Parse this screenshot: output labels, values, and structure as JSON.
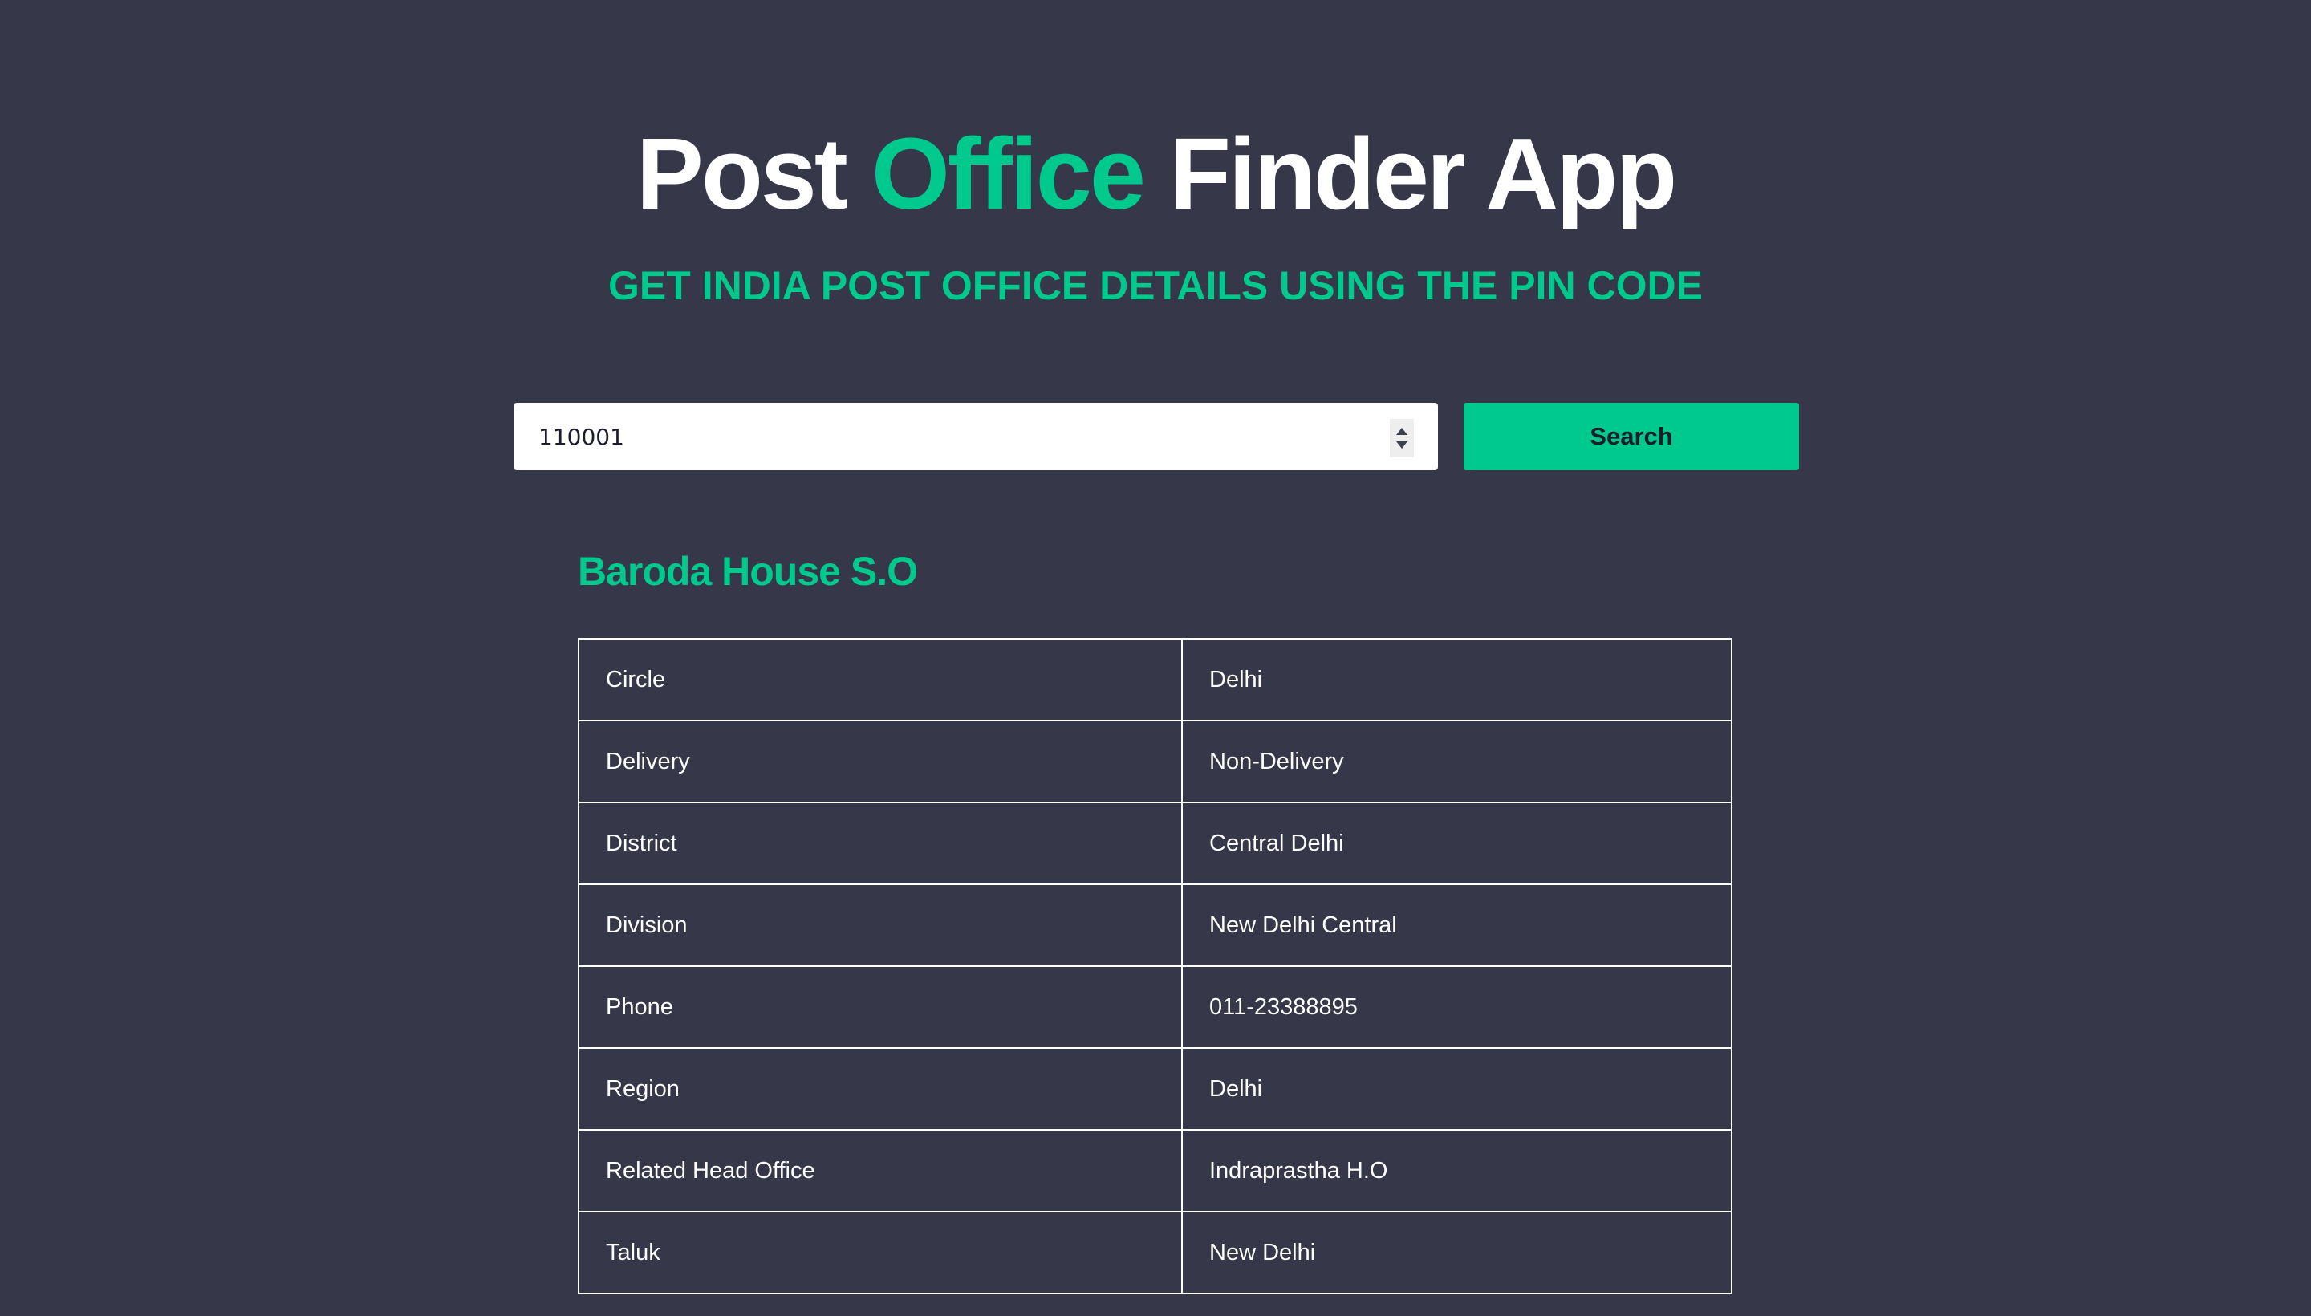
{
  "header": {
    "title_part1": "Post ",
    "title_accent": "Office",
    "title_part2": " Finder App",
    "subtitle": "GET INDIA POST OFFICE DETAILS USING THE PIN CODE"
  },
  "search": {
    "value": "110001",
    "button_label": "Search",
    "spinner_up_icon": "triangle-up",
    "spinner_down_icon": "triangle-down"
  },
  "result": {
    "office_name": "Baroda House S.O",
    "rows": [
      {
        "key": "Circle",
        "value": "Delhi"
      },
      {
        "key": "Delivery",
        "value": "Non-Delivery"
      },
      {
        "key": "District",
        "value": "Central Delhi"
      },
      {
        "key": "Division",
        "value": "New Delhi Central"
      },
      {
        "key": "Phone",
        "value": "011-23388895"
      },
      {
        "key": "Region",
        "value": "Delhi"
      },
      {
        "key": "Related Head Office",
        "value": "Indraprastha H.O"
      },
      {
        "key": "Taluk",
        "value": "New Delhi"
      }
    ]
  },
  "colors": {
    "background": "#363749",
    "accent": "#00c98e",
    "text": "#ffffff",
    "button_text": "#1c1d2a"
  }
}
